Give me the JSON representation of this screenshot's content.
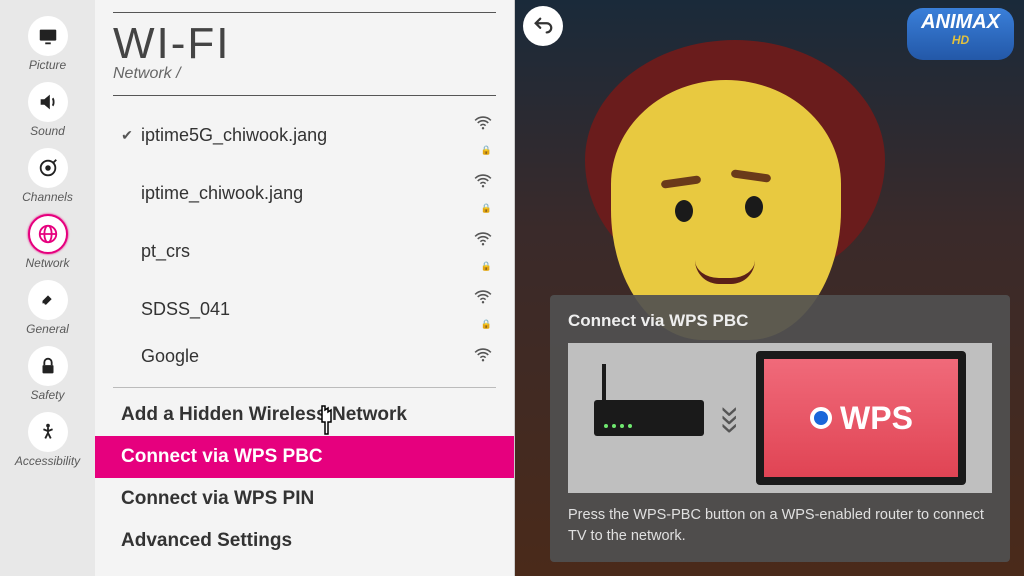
{
  "sidebar": {
    "items": [
      {
        "label": "Picture"
      },
      {
        "label": "Sound"
      },
      {
        "label": "Channels"
      },
      {
        "label": "Network"
      },
      {
        "label": "General"
      },
      {
        "label": "Safety"
      },
      {
        "label": "Accessibility"
      }
    ]
  },
  "panel": {
    "title": "WI-FI",
    "breadcrumb": "Network /"
  },
  "networks": [
    {
      "ssid": "iptime5G_chiwook.jang",
      "connected": true,
      "secured": true
    },
    {
      "ssid": "iptime_chiwook.jang",
      "connected": false,
      "secured": true
    },
    {
      "ssid": "pt_crs",
      "connected": false,
      "secured": true
    },
    {
      "ssid": "SDSS_041",
      "connected": false,
      "secured": true
    },
    {
      "ssid": "Google",
      "connected": false,
      "secured": false
    }
  ],
  "options": [
    {
      "label": "Add a Hidden Wireless Network",
      "selected": false
    },
    {
      "label": "Connect via WPS PBC",
      "selected": true
    },
    {
      "label": "Connect via WPS PIN",
      "selected": false
    },
    {
      "label": "Advanced Settings",
      "selected": false
    }
  ],
  "info": {
    "title": "Connect via WPS PBC",
    "wps_label": "WPS",
    "description": "Press the WPS-PBC button on a WPS-enabled router to connect TV to the network."
  },
  "channel_logo": {
    "name": "ANIMAX",
    "sub": "HD"
  }
}
